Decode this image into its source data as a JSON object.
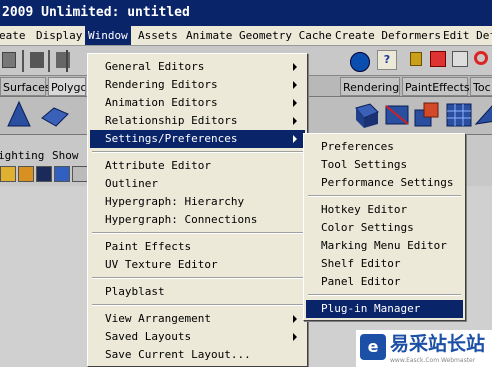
{
  "window": {
    "title": "2009 Unlimited: untitled"
  },
  "menubar": {
    "items": [
      "eate",
      "Display",
      "Window",
      "Assets",
      "Animate",
      "Geometry Cache",
      "Create Deformers",
      "Edit Def"
    ],
    "open_index": 2
  },
  "shelf": {
    "tabs": [
      "Surfaces",
      "Polygo",
      "Rendering",
      "PaintEffects",
      "Toc"
    ],
    "active_index": 1
  },
  "panel_menu": {
    "items": [
      "ighting",
      "Show"
    ]
  },
  "window_menu": {
    "groups": [
      [
        {
          "label": "General Editors",
          "submenu": true
        },
        {
          "label": "Rendering Editors",
          "submenu": true
        },
        {
          "label": "Animation Editors",
          "submenu": true
        },
        {
          "label": "Relationship Editors",
          "submenu": true
        },
        {
          "label": "Settings/Preferences",
          "submenu": true,
          "highlighted": true
        }
      ],
      [
        {
          "label": "Attribute Editor"
        },
        {
          "label": "Outliner"
        },
        {
          "label": "Hypergraph: Hierarchy"
        },
        {
          "label": "Hypergraph: Connections"
        }
      ],
      [
        {
          "label": "Paint Effects"
        },
        {
          "label": "UV Texture Editor"
        }
      ],
      [
        {
          "label": "Playblast"
        }
      ],
      [
        {
          "label": "View Arrangement",
          "submenu": true
        },
        {
          "label": "Saved Layouts",
          "submenu": true
        },
        {
          "label": "Save Current Layout..."
        }
      ]
    ]
  },
  "settings_submenu": {
    "groups": [
      [
        {
          "label": "Preferences"
        },
        {
          "label": "Tool Settings"
        },
        {
          "label": "Performance Settings"
        }
      ],
      [
        {
          "label": "Hotkey Editor"
        },
        {
          "label": "Color Settings"
        },
        {
          "label": "Marking Menu Editor"
        },
        {
          "label": "Shelf Editor"
        },
        {
          "label": "Panel Editor"
        }
      ],
      [
        {
          "label": "Plug-in Manager",
          "highlighted": true
        }
      ]
    ]
  },
  "watermark": {
    "text": "易采站长站",
    "url": "www.Easck.Com Webmaster"
  },
  "colors": {
    "highlight": "#0a246a",
    "menu_bg": "#ece9d8",
    "title_bg": "#0a246a"
  }
}
